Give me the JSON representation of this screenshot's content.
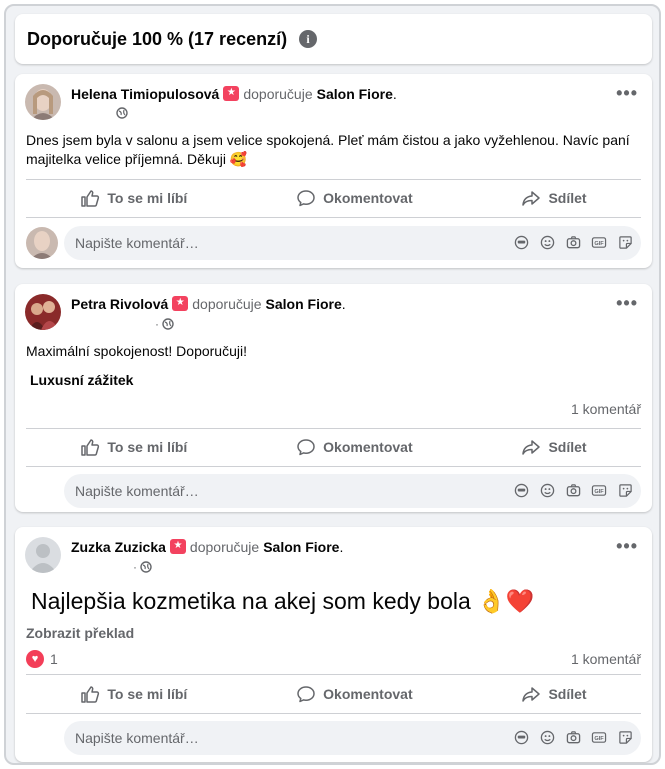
{
  "header": {
    "title": "Doporučuje 100 % (17 recenzí)"
  },
  "common": {
    "recommends": "doporučuje",
    "page": "Salon Fiore",
    "like": "To se mi líbí",
    "comment": "Okomentovat",
    "share": "Sdílet",
    "comment_placeholder": "Napište komentář…",
    "dot": "·"
  },
  "reviews": [
    {
      "author": "Helena Timiopulosová",
      "text": "Dnes jsem byla v salonu a jsem velice spokojená. Pleť mám čistou a jako vyžehlenou. Navíc paní majitelka velice příjemná. Děkuji 🥰"
    },
    {
      "author": "Petra Rivolová",
      "text": "Maximální spokojenost! Doporučuji!",
      "tag": "Luxusní zážitek",
      "comments": "1 komentář"
    },
    {
      "author": "Zuzka Zuzicka",
      "text": "Najlepšia kozmetika na akej som kedy bola 👌❤️",
      "translate": "Zobrazit překlad",
      "reactions": "1",
      "comments": "1 komentář"
    }
  ],
  "colors": {
    "badge": "#f3425f",
    "background": "#f0f2f5",
    "muted": "#65676b"
  }
}
